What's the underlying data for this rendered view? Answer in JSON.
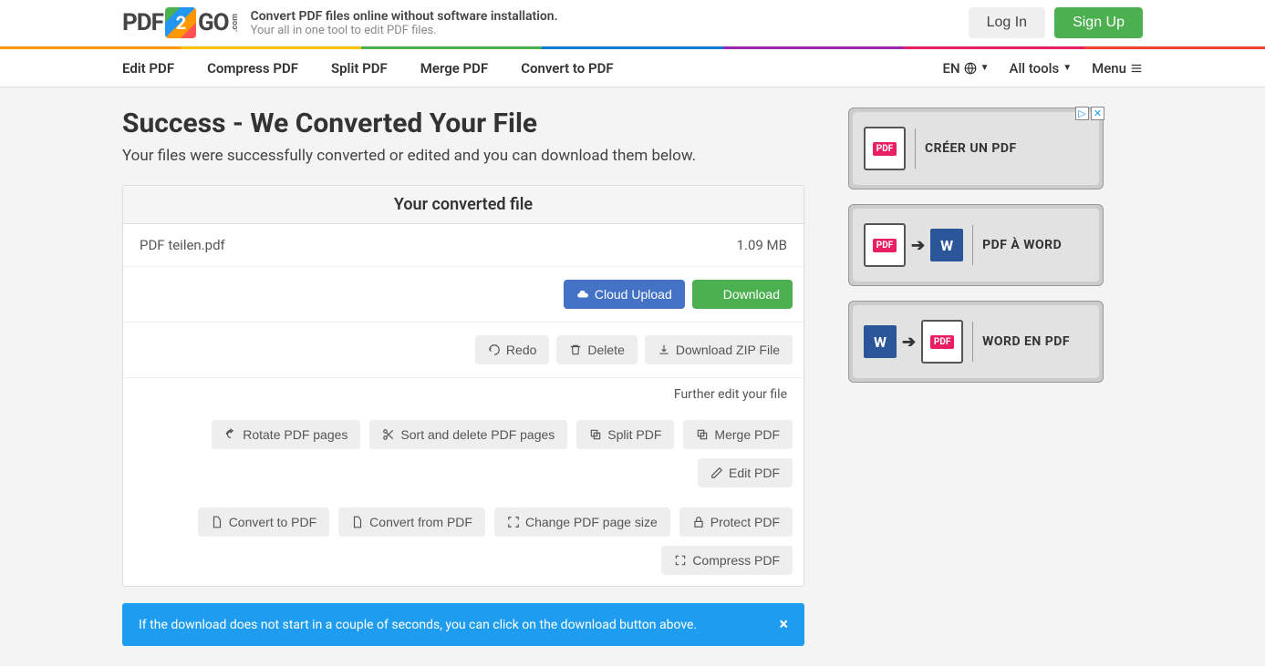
{
  "header": {
    "logo_pdf": "PDF",
    "logo_2": "2",
    "logo_go": "GO",
    "logo_com": ".com",
    "tagline1": "Convert PDF files online without software installation.",
    "tagline2": "Your all in one tool to edit PDF files.",
    "login": "Log In",
    "signup": "Sign Up"
  },
  "colorbar": [
    "#ff9800",
    "#ffc107",
    "#4caf50",
    "#0c7cd5",
    "#9c27b0",
    "#e91e63",
    "#f44336"
  ],
  "nav": {
    "left": [
      "Edit PDF",
      "Compress PDF",
      "Split PDF",
      "Merge PDF",
      "Convert to PDF"
    ],
    "lang": "EN",
    "alltools": "All tools",
    "menu": "Menu"
  },
  "page": {
    "title": "Success - We Converted Your File",
    "subtitle": "Your files were successfully converted or edited and you can download them below."
  },
  "panel": {
    "header": "Your converted file",
    "filename": "PDF teilen.pdf",
    "filesize": "1.09 MB",
    "cloud_upload": "Cloud Upload",
    "download": "Download",
    "redo": "Redo",
    "delete": "Delete",
    "download_zip": "Download ZIP File",
    "further": "Further edit your file",
    "tools_row1": [
      "Rotate PDF pages",
      "Sort and delete PDF pages",
      "Split PDF",
      "Merge PDF",
      "Edit PDF"
    ],
    "tools_row2": [
      "Convert to PDF",
      "Convert from PDF",
      "Change PDF page size",
      "Protect PDF",
      "Compress PDF"
    ]
  },
  "alert": {
    "text": "If the download does not start in a couple of seconds, you can click on the download button above.",
    "close": "×"
  },
  "ads": [
    {
      "label": "CRÉER UN PDF"
    },
    {
      "label": "PDF À WORD"
    },
    {
      "label": "WORD EN PDF"
    }
  ]
}
